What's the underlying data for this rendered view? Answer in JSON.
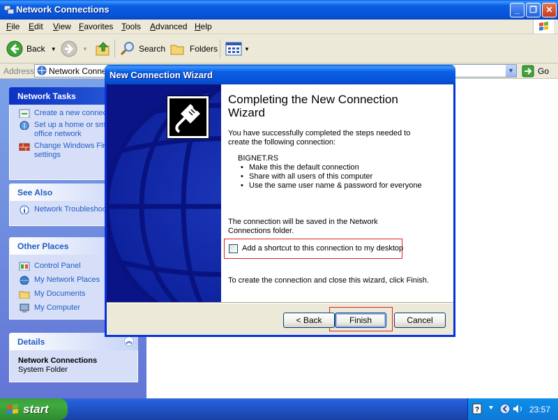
{
  "window": {
    "title": "Network Connections",
    "controls": {
      "minimize": "_",
      "maximize": "❐",
      "close": "✕"
    }
  },
  "menubar": {
    "items": [
      {
        "label": "File",
        "key": "F",
        "rest": "ile"
      },
      {
        "label": "Edit",
        "key": "E",
        "rest": "dit"
      },
      {
        "label": "View",
        "key": "V",
        "rest": "iew"
      },
      {
        "label": "Favorites",
        "key": "F",
        "rest": "avorites"
      },
      {
        "label": "Tools",
        "key": "T",
        "rest": "ools"
      },
      {
        "label": "Advanced",
        "key": "A",
        "rest": "dvanced"
      },
      {
        "label": "Help",
        "key": "H",
        "rest": "elp"
      }
    ]
  },
  "toolbar": {
    "back_label": "Back",
    "search_label": "Search",
    "folders_label": "Folders"
  },
  "address": {
    "label": "Address",
    "value": "Network Connec",
    "go_label": "Go"
  },
  "taskpane": {
    "network_tasks": {
      "title": "Network Tasks",
      "links": [
        "Create a new connec",
        "Set up a home or sma",
        "office network",
        "Change Windows Fire",
        "settings"
      ]
    },
    "see_also": {
      "title": "See Also",
      "links": [
        "Network Troubleshoo"
      ]
    },
    "other_places": {
      "title": "Other Places",
      "links": [
        "Control Panel",
        "My Network Places",
        "My Documents",
        "My Computer"
      ]
    },
    "details": {
      "title": "Details",
      "name": "Network Connections",
      "type": "System Folder"
    }
  },
  "wizard": {
    "title": "New Connection Wizard",
    "heading": "Completing the New Connection Wizard",
    "intro": "You have successfully completed the steps needed to create the following connection:",
    "connection_name": "BIGNET.RS",
    "bullets": [
      "Make this the default connection",
      "Share with all users of this computer",
      "Use the same user name & password for everyone"
    ],
    "saved_note": "The connection will be saved in the Network Connections folder.",
    "checkbox": {
      "label": "Add a shortcut to this connection to my desktop",
      "checked": false
    },
    "finish_note": "To create the connection and close this wizard, click Finish.",
    "buttons": {
      "back": "< Back",
      "finish": "Finish",
      "cancel": "Cancel"
    }
  },
  "taskbar": {
    "start_label": "start",
    "clock": "23:57"
  },
  "colors": {
    "xp_blue": "#0a5fe3",
    "taskpane_bg": "#7ba2e7",
    "link_blue": "#215dc6",
    "highlight_red": "#e02020",
    "start_green": "#3c9d3c"
  }
}
